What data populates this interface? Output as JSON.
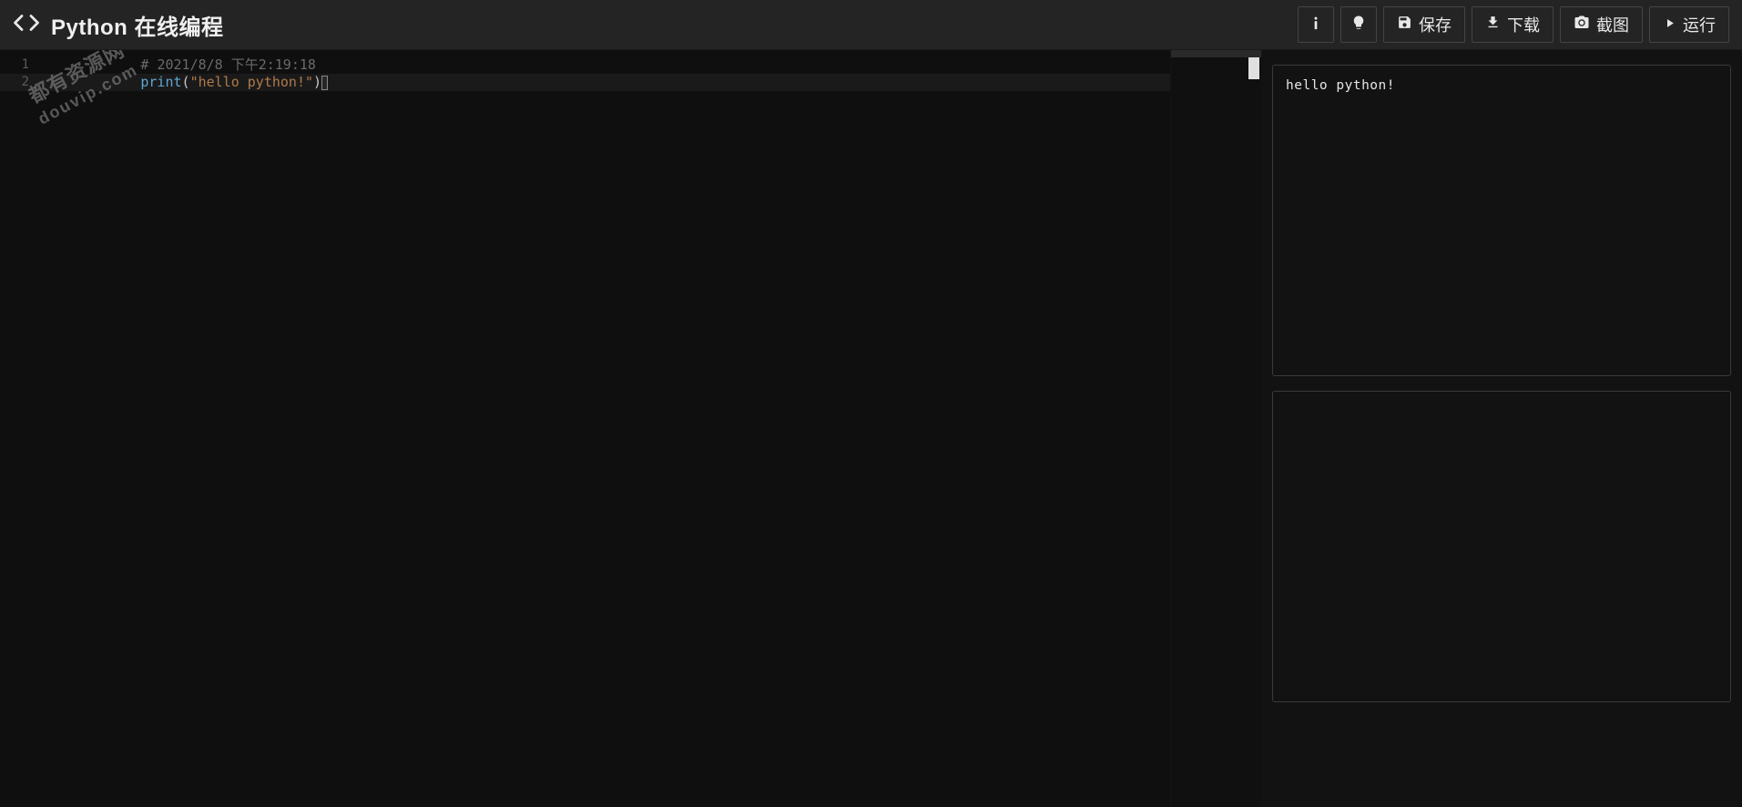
{
  "header": {
    "title": "Python 在线编程",
    "buttons": {
      "info_title": "info",
      "hint_title": "hint",
      "save": "保存",
      "download": "下载",
      "screenshot": "截图",
      "run": "运行"
    }
  },
  "editor": {
    "lines": [
      {
        "num": "1",
        "comment_prefix": "# ",
        "comment_rest": "2021/8/8 下午2:19:18"
      },
      {
        "num": "2",
        "func": "print",
        "open": "(",
        "str": "\"hello python!\"",
        "close": ")"
      }
    ]
  },
  "output": {
    "text": "hello python!"
  },
  "watermark": {
    "line1": "都有资源网",
    "line2": "douvip.com"
  }
}
